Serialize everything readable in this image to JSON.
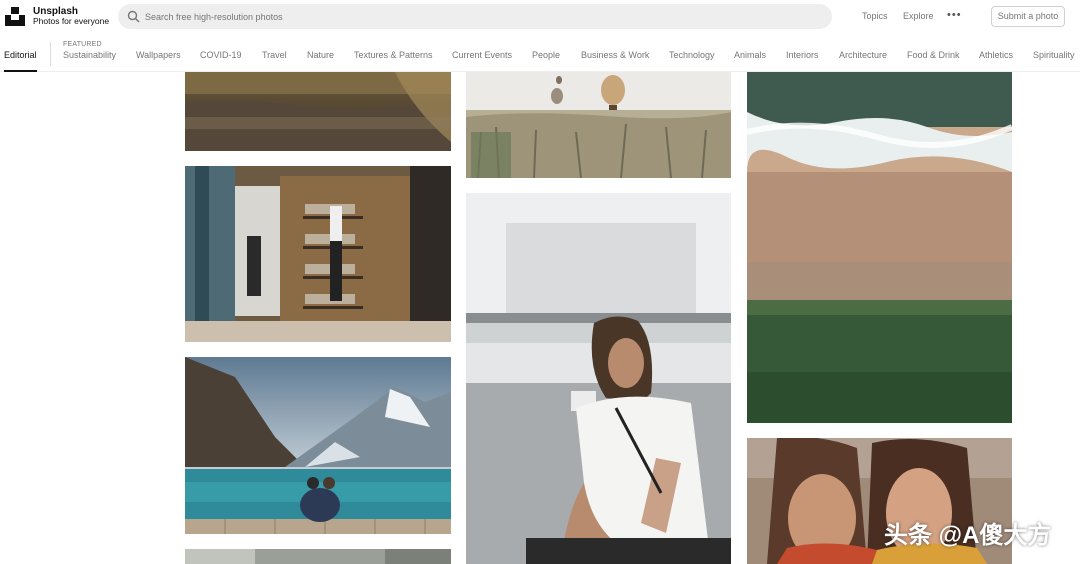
{
  "brand": {
    "name": "Unsplash",
    "tagline": "Photos for everyone"
  },
  "search": {
    "placeholder": "Search free high-resolution photos"
  },
  "top_links": {
    "topics": "Topics",
    "explore": "Explore",
    "submit": "Submit a photo"
  },
  "nav": {
    "editorial": "Editorial",
    "featured_label": "FEATURED",
    "items": [
      "Sustainability",
      "Wallpapers",
      "COVID-19",
      "Travel",
      "Nature",
      "Textures & Patterns",
      "Current Events",
      "People",
      "Business & Work",
      "Technology",
      "Animals",
      "Interiors",
      "Architecture",
      "Food & Drink",
      "Athletics",
      "Spirituality"
    ]
  },
  "watermark": "头条 @A傻大方",
  "colors": {
    "active_underline": "#111111",
    "search_bg": "#eeeeee",
    "muted_text": "#767676"
  }
}
